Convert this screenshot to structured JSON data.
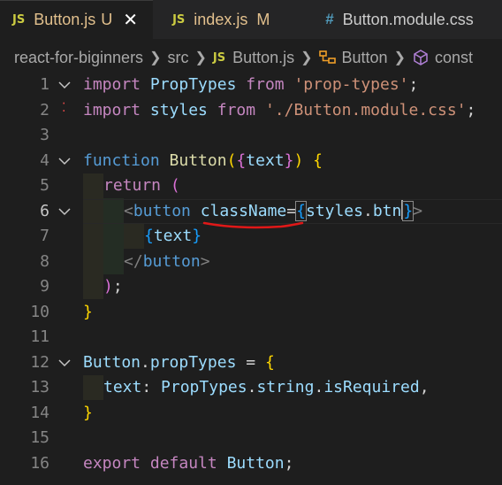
{
  "tabs": [
    {
      "icon": "JS",
      "label": "Button.js",
      "git": "U",
      "close": "✕",
      "active": true
    },
    {
      "icon": "JS",
      "label": "index.js",
      "git": "M",
      "active": false
    },
    {
      "icon": "#",
      "label": "Button.module.css",
      "active": false
    }
  ],
  "breadcrumb": {
    "folder": "react-for-biginners",
    "src": "src",
    "file_icon": "JS",
    "file": "Button.js",
    "component": "Button",
    "const": "const"
  },
  "lines": [
    "1",
    "2",
    "3",
    "4",
    "5",
    "6",
    "7",
    "8",
    "9",
    "10",
    "11",
    "12",
    "13",
    "14",
    "15",
    "16"
  ],
  "code": {
    "l1": {
      "import": "import",
      "name": "PropTypes",
      "from": "from",
      "module": "'prop-types'",
      "semi": ";"
    },
    "l2": {
      "import": "import",
      "name": "styles",
      "from": "from",
      "module": "'./Button.module.css'",
      "semi": ";"
    },
    "l4": {
      "function": "function",
      "name": "Button",
      "open": "(",
      "brace_open": "{",
      "param": "text",
      "brace_close": "}",
      "close": ")",
      "body_open": "{"
    },
    "l5": {
      "return": "return",
      "paren": "("
    },
    "l6": {
      "lt": "<",
      "tag": "button",
      "attr": "className",
      "eq": "=",
      "brace_open": "{",
      "obj": "styles",
      "dot": ".",
      "prop": "btn",
      "brace_close": "}",
      "gt": ">"
    },
    "l7": {
      "brace_open": "{",
      "expr": "text",
      "brace_close": "}"
    },
    "l8": {
      "lt": "</",
      "tag": "button",
      "gt": ">"
    },
    "l9": {
      "paren": ")",
      "semi": ";"
    },
    "l10": {
      "brace": "}"
    },
    "l12": {
      "name": "Button",
      "dot": ".",
      "prop": "propTypes",
      "eq": " = ",
      "brace": "{"
    },
    "l13": {
      "key": "text",
      "colon": ": ",
      "obj": "PropTypes",
      "dot1": ".",
      "p1": "string",
      "dot2": ".",
      "p2": "isRequired",
      "comma": ","
    },
    "l14": {
      "brace": "}"
    },
    "l16": {
      "export": "export",
      "default": "default",
      "name": "Button",
      "semi": ";"
    }
  },
  "colors": {
    "annotation": "#e01818",
    "error_dots": "#f14c4c",
    "keyword": "#569cd6",
    "control": "#c586c0",
    "string": "#ce9178",
    "variable": "#9cdcfe",
    "function": "#dcdcaa"
  }
}
